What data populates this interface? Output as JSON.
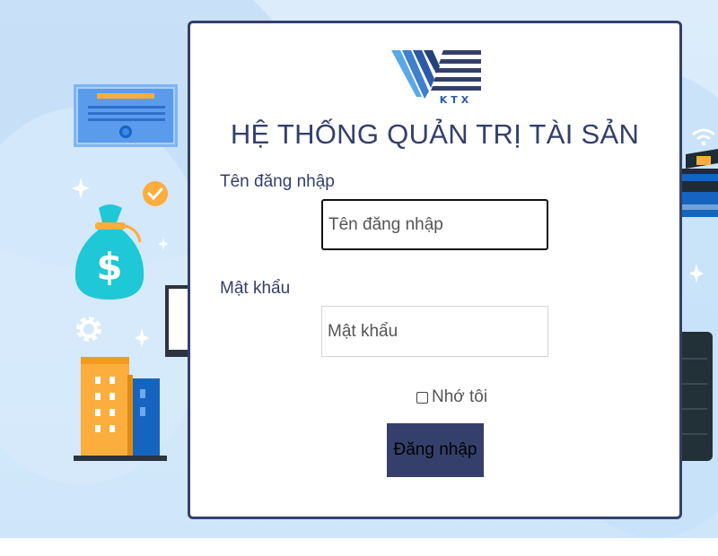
{
  "app": {
    "title": "HỆ THỐNG QUẢN TRỊ TÀI SẢN",
    "logo_text": "KTX"
  },
  "form": {
    "username_label": "Tên đăng nhập",
    "username_placeholder": "Tên đăng nhập",
    "password_label": "Mật khẩu",
    "password_placeholder": "Mật khẩu",
    "remember_label": "Nhớ tôi",
    "remember_checked": false,
    "submit_label": "Đăng nhập"
  },
  "theme": {
    "primary": "#34406b",
    "background": "#cfe6fa",
    "accent_orange": "#fbad3d",
    "accent_blue": "#1565c0",
    "accent_teal": "#1ec8d6"
  },
  "decorations": [
    "certificate-icon",
    "sparkle-icon",
    "money-bag-icon",
    "check-badge-icon",
    "gear-icon",
    "building-icon",
    "monitor-icon",
    "wifi-icon",
    "credit-card-icon",
    "server-icon"
  ]
}
